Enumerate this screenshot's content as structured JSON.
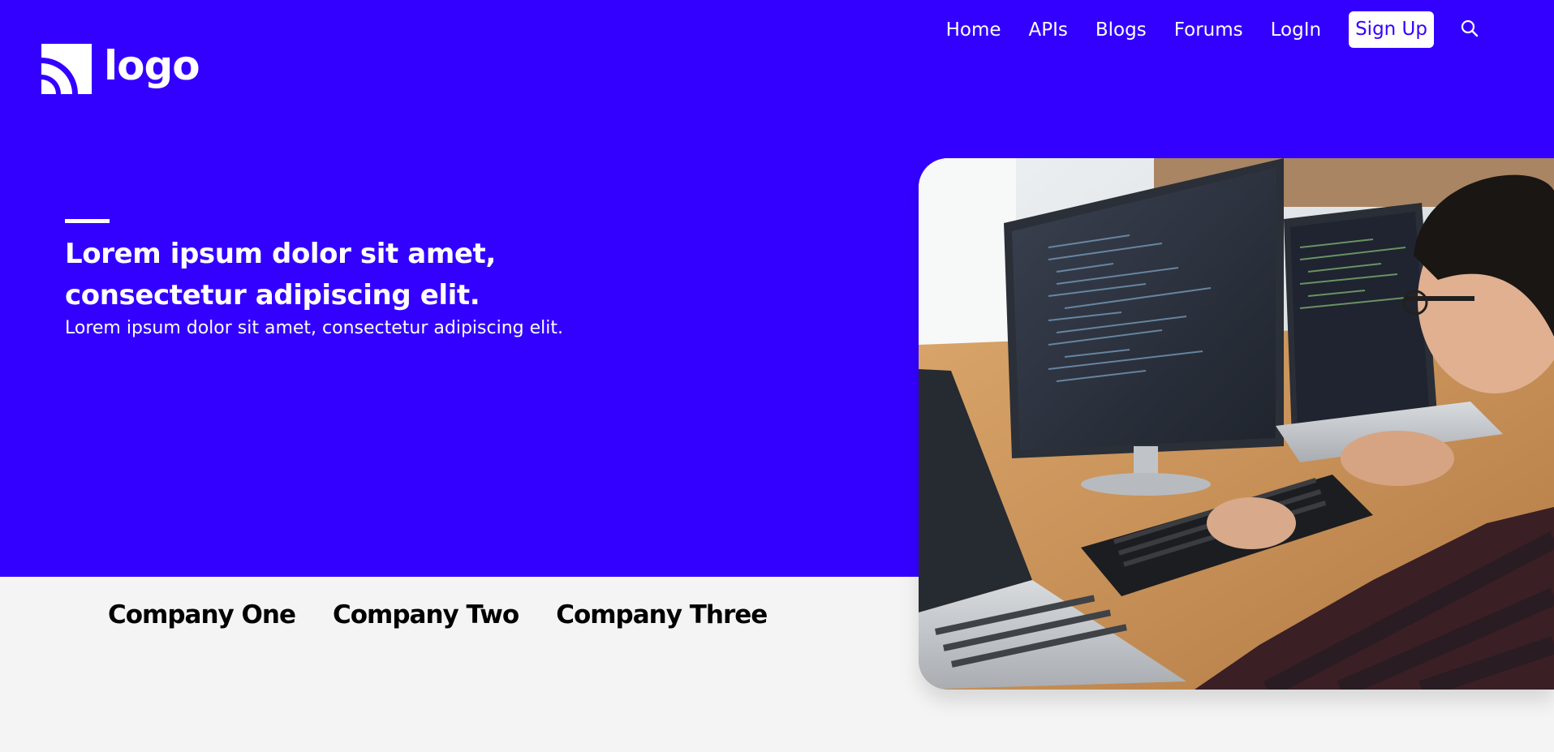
{
  "brand": {
    "logo_text": "logo",
    "logo_icon": "wifi-arcs-icon"
  },
  "nav": {
    "items": [
      {
        "label": "Home"
      },
      {
        "label": "APIs"
      },
      {
        "label": "Blogs"
      },
      {
        "label": "Forums"
      },
      {
        "label": "LogIn"
      }
    ],
    "signup_label": "Sign Up",
    "search_icon": "search-icon"
  },
  "hero": {
    "headline_line1": "Lorem ipsum dolor sit amet,",
    "headline_line2": "consectetur adipiscing elit.",
    "subheadline": "Lorem ipsum dolor sit amet, consectetur adipiscing elit.",
    "image": "developer-at-computer-photo"
  },
  "companies": [
    {
      "name": "Company One"
    },
    {
      "name": "Company Two"
    },
    {
      "name": "Company Three"
    }
  ],
  "colors": {
    "primary": "#3300ff",
    "background": "#f4f4f4",
    "text_on_primary": "#ffffff",
    "company_text": "#000000"
  }
}
